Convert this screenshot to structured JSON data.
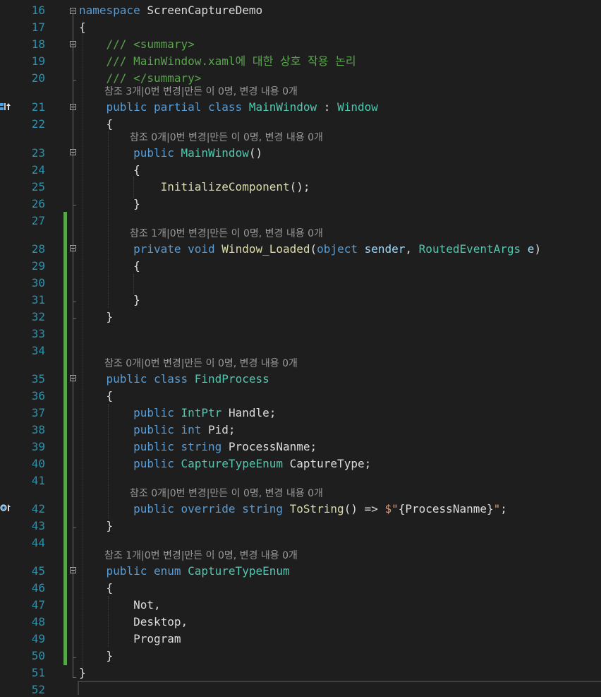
{
  "editor": {
    "lines": [
      {
        "n": "16",
        "segs": [
          {
            "t": "namespace",
            "c": "kw"
          },
          {
            "t": " ScreenCaptureDemo",
            "c": "plain"
          }
        ]
      },
      {
        "n": "17",
        "segs": [
          {
            "t": "{",
            "c": "plain"
          }
        ]
      },
      {
        "n": "18",
        "segs": [
          {
            "t": "    /// <summary>",
            "c": "cm"
          }
        ]
      },
      {
        "n": "19",
        "segs": [
          {
            "t": "    /// MainWindow.xaml에 대한 상호 작용 논리",
            "c": "cm"
          }
        ]
      },
      {
        "n": "20",
        "segs": [
          {
            "t": "    /// </summary>",
            "c": "cm"
          }
        ]
      },
      {
        "n": "21",
        "segs": [
          {
            "t": "    ",
            "c": "plain"
          },
          {
            "t": "public partial class ",
            "c": "kw"
          },
          {
            "t": "MainWindow",
            "c": "ty"
          },
          {
            "t": " : ",
            "c": "plain"
          },
          {
            "t": "Window",
            "c": "ty"
          }
        ]
      },
      {
        "n": "22",
        "segs": [
          {
            "t": "    {",
            "c": "plain"
          }
        ]
      },
      {
        "n": "23",
        "segs": [
          {
            "t": "        ",
            "c": "plain"
          },
          {
            "t": "public ",
            "c": "kw"
          },
          {
            "t": "MainWindow",
            "c": "ty"
          },
          {
            "t": "()",
            "c": "plain"
          }
        ]
      },
      {
        "n": "24",
        "segs": [
          {
            "t": "        {",
            "c": "plain"
          }
        ]
      },
      {
        "n": "25",
        "segs": [
          {
            "t": "            ",
            "c": "plain"
          },
          {
            "t": "InitializeComponent",
            "c": "fn"
          },
          {
            "t": "();",
            "c": "plain"
          }
        ]
      },
      {
        "n": "26",
        "segs": [
          {
            "t": "        }",
            "c": "plain"
          }
        ]
      },
      {
        "n": "27",
        "segs": []
      },
      {
        "n": "28",
        "segs": [
          {
            "t": "        ",
            "c": "plain"
          },
          {
            "t": "private void ",
            "c": "kw"
          },
          {
            "t": "Window_Loaded",
            "c": "fn"
          },
          {
            "t": "(",
            "c": "plain"
          },
          {
            "t": "object ",
            "c": "kw"
          },
          {
            "t": "sender",
            "c": "va"
          },
          {
            "t": ", ",
            "c": "plain"
          },
          {
            "t": "RoutedEventArgs ",
            "c": "ty"
          },
          {
            "t": "e",
            "c": "va"
          },
          {
            "t": ")",
            "c": "plain"
          }
        ]
      },
      {
        "n": "29",
        "segs": [
          {
            "t": "        {",
            "c": "plain"
          }
        ]
      },
      {
        "n": "30",
        "segs": []
      },
      {
        "n": "31",
        "segs": [
          {
            "t": "        }",
            "c": "plain"
          }
        ]
      },
      {
        "n": "32",
        "segs": [
          {
            "t": "    }",
            "c": "plain"
          }
        ]
      },
      {
        "n": "33",
        "segs": []
      },
      {
        "n": "34",
        "segs": []
      },
      {
        "n": "35",
        "segs": [
          {
            "t": "    ",
            "c": "plain"
          },
          {
            "t": "public class ",
            "c": "kw"
          },
          {
            "t": "FindProcess",
            "c": "ty"
          }
        ]
      },
      {
        "n": "36",
        "segs": [
          {
            "t": "    {",
            "c": "plain"
          }
        ]
      },
      {
        "n": "37",
        "segs": [
          {
            "t": "        ",
            "c": "plain"
          },
          {
            "t": "public ",
            "c": "kw"
          },
          {
            "t": "IntPtr ",
            "c": "ty"
          },
          {
            "t": "Handle;",
            "c": "plain"
          }
        ]
      },
      {
        "n": "38",
        "segs": [
          {
            "t": "        ",
            "c": "plain"
          },
          {
            "t": "public int ",
            "c": "kw"
          },
          {
            "t": "Pid;",
            "c": "plain"
          }
        ]
      },
      {
        "n": "39",
        "segs": [
          {
            "t": "        ",
            "c": "plain"
          },
          {
            "t": "public string ",
            "c": "kw"
          },
          {
            "t": "ProcessNanme;",
            "c": "plain"
          }
        ]
      },
      {
        "n": "40",
        "segs": [
          {
            "t": "        ",
            "c": "plain"
          },
          {
            "t": "public ",
            "c": "kw"
          },
          {
            "t": "CaptureTypeEnum ",
            "c": "ty"
          },
          {
            "t": "CaptureType;",
            "c": "plain"
          }
        ]
      },
      {
        "n": "41",
        "segs": []
      },
      {
        "n": "42",
        "segs": [
          {
            "t": "        ",
            "c": "plain"
          },
          {
            "t": "public override string ",
            "c": "kw"
          },
          {
            "t": "ToString",
            "c": "fn"
          },
          {
            "t": "() => ",
            "c": "plain"
          },
          {
            "t": "$\"",
            "c": "st"
          },
          {
            "t": "{ProcessNanme}",
            "c": "plain"
          },
          {
            "t": "\"",
            "c": "st"
          },
          {
            "t": ";",
            "c": "plain"
          }
        ]
      },
      {
        "n": "43",
        "segs": [
          {
            "t": "    }",
            "c": "plain"
          }
        ]
      },
      {
        "n": "44",
        "segs": []
      },
      {
        "n": "45",
        "segs": [
          {
            "t": "    ",
            "c": "plain"
          },
          {
            "t": "public enum ",
            "c": "kw"
          },
          {
            "t": "CaptureTypeEnum",
            "c": "ty"
          }
        ]
      },
      {
        "n": "46",
        "segs": [
          {
            "t": "    {",
            "c": "plain"
          }
        ]
      },
      {
        "n": "47",
        "segs": [
          {
            "t": "        Not,",
            "c": "plain"
          }
        ]
      },
      {
        "n": "48",
        "segs": [
          {
            "t": "        Desktop,",
            "c": "plain"
          }
        ]
      },
      {
        "n": "49",
        "segs": [
          {
            "t": "        Program",
            "c": "plain"
          }
        ]
      },
      {
        "n": "50",
        "segs": [
          {
            "t": "    }",
            "c": "plain"
          }
        ]
      },
      {
        "n": "51",
        "segs": [
          {
            "t": "}",
            "c": "plain"
          }
        ]
      },
      {
        "n": "52",
        "segs": []
      }
    ],
    "codelens": {
      "class_main": "참조 3개|0번 변경|만든 이 0명, 변경 내용 0개",
      "ctor": "참조 0개|0번 변경|만든 이 0명, 변경 내용 0개",
      "window_loaded": "참조 1개|0번 변경|만든 이 0명, 변경 내용 0개",
      "class_find": "참조 0개|0번 변경|만든 이 0명, 변경 내용 0개",
      "tostring": "참조 0개|0번 변경|만든 이 0명, 변경 내용 0개",
      "enum": "참조 1개|0번 변경|만든 이 0명, 변경 내용 0개"
    },
    "gutter_icons": [
      "implements-icon",
      "override-icon"
    ],
    "colors": {
      "background": "#1e1e1e",
      "line_number": "#2b91af",
      "keyword": "#569cd6",
      "type": "#4ec9b0",
      "method": "#dcdcaa",
      "parameter": "#9cdcfe",
      "comment": "#57a64a",
      "string": "#d69d85",
      "codelens": "#999999",
      "change_bar": "#57a64a"
    }
  }
}
